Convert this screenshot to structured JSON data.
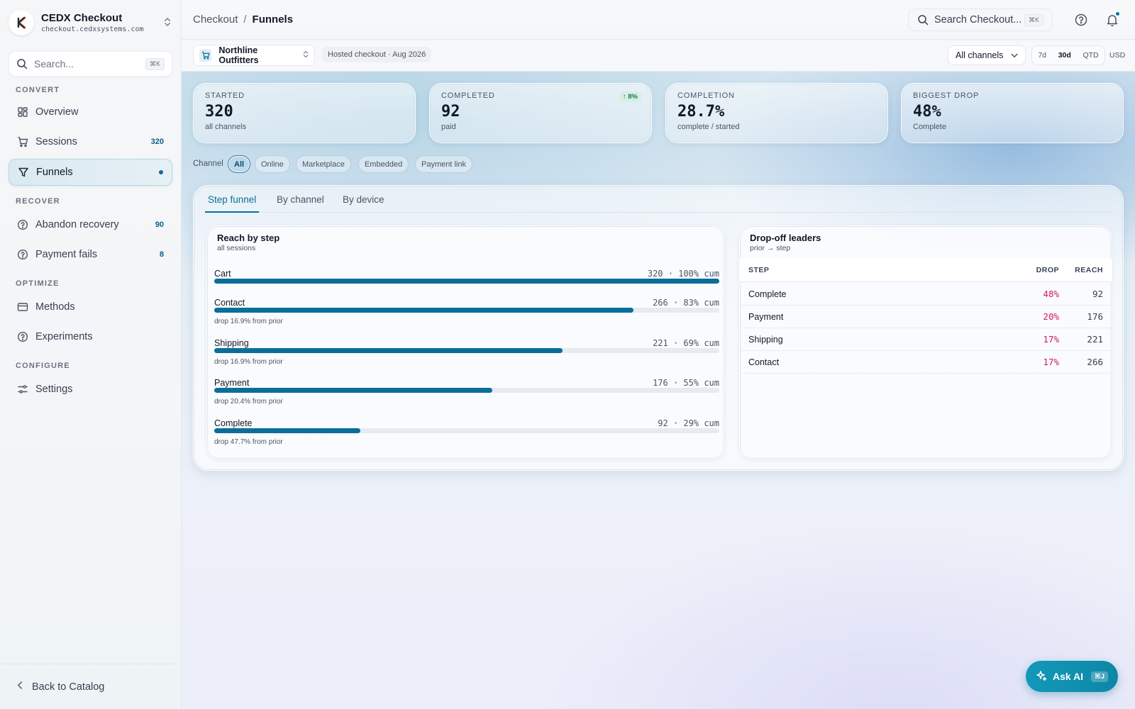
{
  "app": {
    "name": "CEDX Checkout",
    "domain": "checkout.cedxsystems.com"
  },
  "sidebar": {
    "search_placeholder": "Search...",
    "search_shortcut": "⌘K",
    "sections": {
      "convert": "CONVERT",
      "recover": "RECOVER",
      "optimize": "OPTIMIZE",
      "configure": "CONFIGURE"
    },
    "items": [
      {
        "label": "Overview",
        "icon": "grid-icon"
      },
      {
        "label": "Sessions",
        "count": "320",
        "icon": "cart-icon"
      },
      {
        "label": "Funnels",
        "icon": "filter-icon",
        "active": true
      },
      {
        "label": "Abandon recovery",
        "count": "90",
        "icon": "help-circle-icon"
      },
      {
        "label": "Payment fails",
        "count": "8",
        "icon": "help-circle-icon"
      },
      {
        "label": "Methods",
        "icon": "card-icon"
      },
      {
        "label": "Experiments",
        "icon": "help-circle-icon"
      },
      {
        "label": "Settings",
        "icon": "sliders-icon"
      }
    ],
    "back_label": "Back to Catalog"
  },
  "topbar": {
    "breadcrumb_parent": "Checkout",
    "breadcrumb_sep": "/",
    "breadcrumb_current": "Funnels",
    "search_placeholder": "Search Checkout...",
    "search_shortcut": "⌘K"
  },
  "subbar": {
    "store": "Northline Outfitters",
    "meta": "Hosted checkout · Aug 2026",
    "channel_select": "All channels",
    "ranges": [
      "7d",
      "30d",
      "QTD"
    ],
    "selected_range": "30d",
    "currency": "USD"
  },
  "kpis": [
    {
      "label": "STARTED",
      "value": "320",
      "sub": "all channels"
    },
    {
      "label": "COMPLETED",
      "value": "92",
      "sub": "paid",
      "badge": "↑ 8%"
    },
    {
      "label": "COMPLETION",
      "value": "28.7%",
      "sub": "complete / started"
    },
    {
      "label": "BIGGEST DROP",
      "value": "48%",
      "sub": "Complete"
    }
  ],
  "channel_filter": {
    "label": "Channel",
    "options": [
      "All",
      "Online",
      "Marketplace",
      "Embedded",
      "Payment link"
    ],
    "selected": "All"
  },
  "tabs": [
    "Step funnel",
    "By channel",
    "By device"
  ],
  "reach_card": {
    "title": "Reach by step",
    "subtitle": "all sessions",
    "steps": [
      {
        "name": "Cart",
        "meta": "320 · 100% cum",
        "pct": 1.0,
        "drop": ""
      },
      {
        "name": "Contact",
        "meta": "266 · 83% cum",
        "pct": 0.83,
        "drop": "drop 16.9% from prior"
      },
      {
        "name": "Shipping",
        "meta": "221 · 69% cum",
        "pct": 0.69,
        "drop": "drop 16.9% from prior"
      },
      {
        "name": "Payment",
        "meta": "176 · 55% cum",
        "pct": 0.55,
        "drop": "drop 20.4% from prior"
      },
      {
        "name": "Complete",
        "meta": "92 · 29% cum",
        "pct": 0.29,
        "drop": "drop 47.7% from prior"
      }
    ]
  },
  "dropoff_card": {
    "title": "Drop-off leaders",
    "subtitle": "prior → step",
    "columns": [
      "STEP",
      "DROP",
      "REACH"
    ],
    "rows": [
      {
        "step": "Complete",
        "drop": "48%",
        "reach": "92"
      },
      {
        "step": "Payment",
        "drop": "20%",
        "reach": "176"
      },
      {
        "step": "Shipping",
        "drop": "17%",
        "reach": "221"
      },
      {
        "step": "Contact",
        "drop": "17%",
        "reach": "266"
      }
    ]
  },
  "ask_ai": {
    "label": "Ask AI",
    "shortcut": "⌘J"
  }
}
